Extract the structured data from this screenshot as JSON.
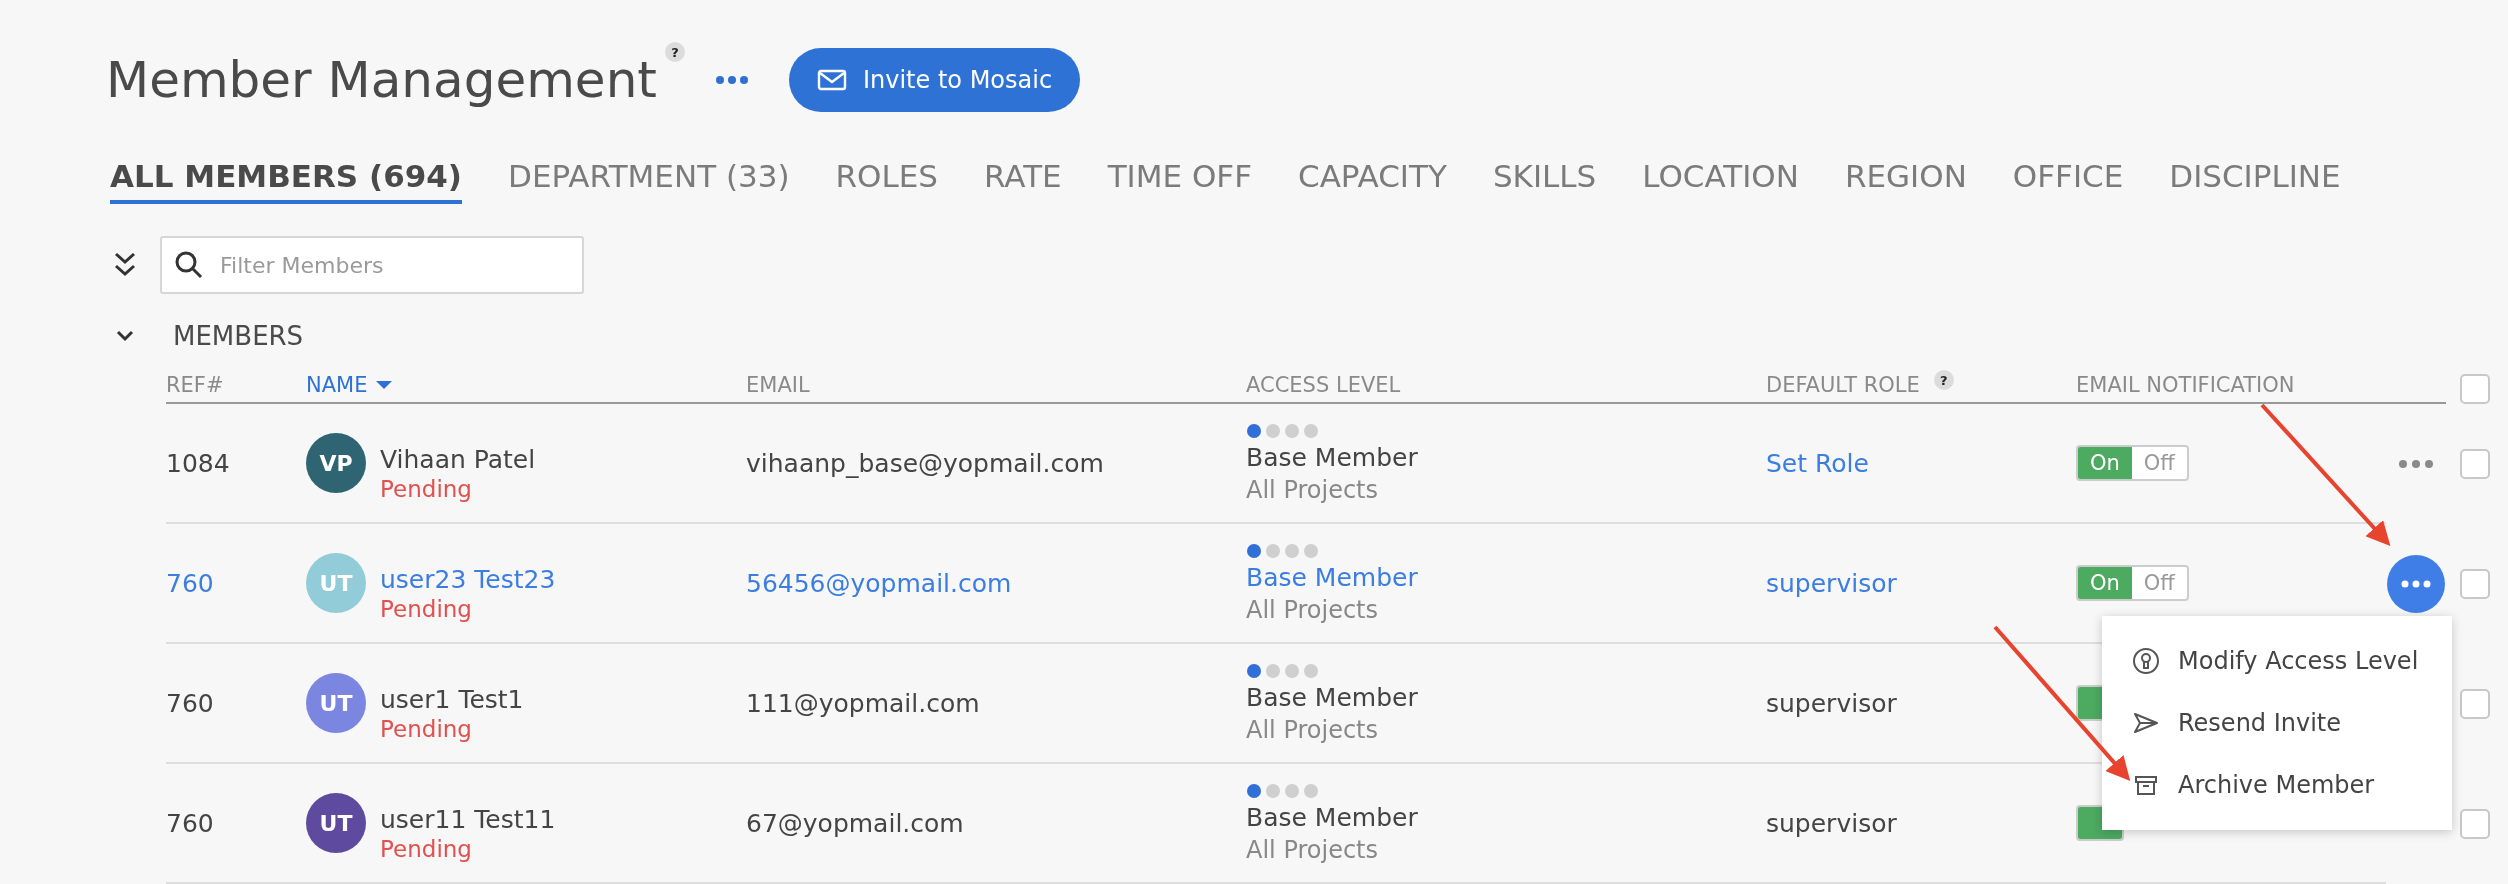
{
  "header": {
    "title": "Member Management",
    "help_mark": "?",
    "invite_button": "Invite to Mosaic"
  },
  "tabs": [
    {
      "label": "ALL MEMBERS (694)",
      "selected": true
    },
    {
      "label": "DEPARTMENT (33)",
      "selected": false
    },
    {
      "label": "ROLES",
      "selected": false
    },
    {
      "label": "RATE",
      "selected": false
    },
    {
      "label": "TIME OFF",
      "selected": false
    },
    {
      "label": "CAPACITY",
      "selected": false
    },
    {
      "label": "SKILLS",
      "selected": false
    },
    {
      "label": "LOCATION",
      "selected": false
    },
    {
      "label": "REGION",
      "selected": false
    },
    {
      "label": "OFFICE",
      "selected": false
    },
    {
      "label": "DISCIPLINE",
      "selected": false
    }
  ],
  "search": {
    "placeholder": "Filter Members"
  },
  "section": {
    "title": "MEMBERS",
    "expanded": true
  },
  "table": {
    "columns": [
      {
        "label": "REF#",
        "sorted": false
      },
      {
        "label": "NAME",
        "sorted": true
      },
      {
        "label": "EMAIL",
        "sorted": false
      },
      {
        "label": "ACCESS LEVEL",
        "sorted": false
      },
      {
        "label": "DEFAULT ROLE",
        "sorted": false,
        "help_mark": "?"
      },
      {
        "label": "EMAIL NOTIFICATION",
        "sorted": false
      }
    ],
    "select_all": {
      "checked": false
    },
    "rows": [
      {
        "ref": "1084",
        "initials": "VP",
        "color": "#2f6472",
        "name": "Vihaan Patel",
        "status": "Pending",
        "email": "vihaanp_base@yopmail.com",
        "level": 0.25,
        "access_level": "Base Member",
        "access_scope": "All Projects",
        "default_role": "Set Role",
        "role_is_link": true,
        "notification": {
          "on": true,
          "on_label": "On",
          "off_label": "Off"
        },
        "hovered": false,
        "menu_open": false,
        "checked": false
      },
      {
        "ref": "760",
        "initials": "UT",
        "color": "#93ccd9",
        "name": "user23 Test23",
        "status": "Pending",
        "email": "56456@yopmail.com",
        "level": 0.25,
        "access_level": "Base Member",
        "access_scope": "All Projects",
        "default_role": "supervisor",
        "role_is_link": false,
        "notification": {
          "on": true,
          "on_label": "On",
          "off_label": "Off"
        },
        "hovered": true,
        "menu_open": true,
        "checked": false
      },
      {
        "ref": "760",
        "initials": "UT",
        "color": "#7b86e0",
        "name": "user1 Test1",
        "status": "Pending",
        "email": "111@yopmail.com",
        "level": 0.25,
        "access_level": "Base Member",
        "access_scope": "All Projects",
        "default_role": "supervisor",
        "role_is_link": false,
        "notification": {
          "on": true
        },
        "hovered": false,
        "menu_open": false,
        "checked": false
      },
      {
        "ref": "760",
        "initials": "UT",
        "color": "#5e4a9e",
        "name": "user11 Test11",
        "status": "Pending",
        "email": "67@yopmail.com",
        "level": 0.25,
        "access_level": "Base Member",
        "access_scope": "All Projects",
        "default_role": "supervisor",
        "role_is_link": false,
        "notification": {
          "on": true
        },
        "hovered": false,
        "menu_open": false,
        "checked": false
      }
    ]
  },
  "row_menu": {
    "items": [
      {
        "label": "Modify Access Level",
        "kind": "access"
      },
      {
        "label": "Resend Invite",
        "kind": "send"
      },
      {
        "label": "Archive Member",
        "kind": "archive"
      }
    ]
  }
}
